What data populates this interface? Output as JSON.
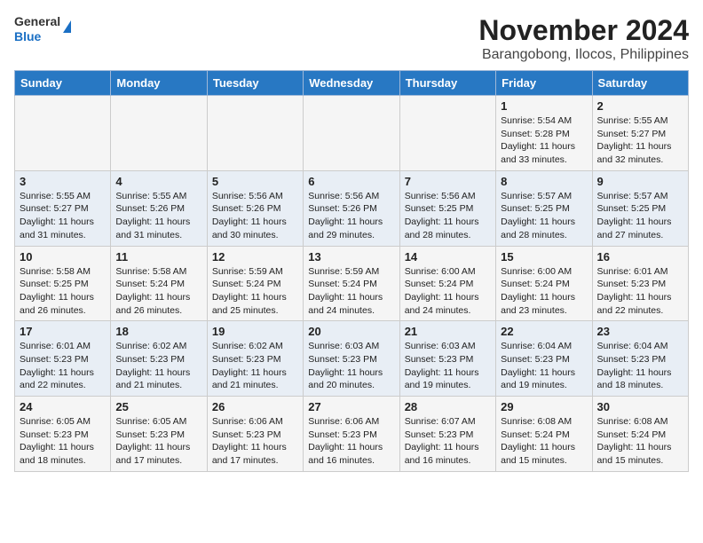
{
  "header": {
    "logo_general": "General",
    "logo_blue": "Blue",
    "title": "November 2024",
    "subtitle": "Barangobong, Ilocos, Philippines"
  },
  "weekdays": [
    "Sunday",
    "Monday",
    "Tuesday",
    "Wednesday",
    "Thursday",
    "Friday",
    "Saturday"
  ],
  "weeks": [
    [
      {
        "day": "",
        "info": ""
      },
      {
        "day": "",
        "info": ""
      },
      {
        "day": "",
        "info": ""
      },
      {
        "day": "",
        "info": ""
      },
      {
        "day": "",
        "info": ""
      },
      {
        "day": "1",
        "info": "Sunrise: 5:54 AM\nSunset: 5:28 PM\nDaylight: 11 hours\nand 33 minutes."
      },
      {
        "day": "2",
        "info": "Sunrise: 5:55 AM\nSunset: 5:27 PM\nDaylight: 11 hours\nand 32 minutes."
      }
    ],
    [
      {
        "day": "3",
        "info": "Sunrise: 5:55 AM\nSunset: 5:27 PM\nDaylight: 11 hours\nand 31 minutes."
      },
      {
        "day": "4",
        "info": "Sunrise: 5:55 AM\nSunset: 5:26 PM\nDaylight: 11 hours\nand 31 minutes."
      },
      {
        "day": "5",
        "info": "Sunrise: 5:56 AM\nSunset: 5:26 PM\nDaylight: 11 hours\nand 30 minutes."
      },
      {
        "day": "6",
        "info": "Sunrise: 5:56 AM\nSunset: 5:26 PM\nDaylight: 11 hours\nand 29 minutes."
      },
      {
        "day": "7",
        "info": "Sunrise: 5:56 AM\nSunset: 5:25 PM\nDaylight: 11 hours\nand 28 minutes."
      },
      {
        "day": "8",
        "info": "Sunrise: 5:57 AM\nSunset: 5:25 PM\nDaylight: 11 hours\nand 28 minutes."
      },
      {
        "day": "9",
        "info": "Sunrise: 5:57 AM\nSunset: 5:25 PM\nDaylight: 11 hours\nand 27 minutes."
      }
    ],
    [
      {
        "day": "10",
        "info": "Sunrise: 5:58 AM\nSunset: 5:25 PM\nDaylight: 11 hours\nand 26 minutes."
      },
      {
        "day": "11",
        "info": "Sunrise: 5:58 AM\nSunset: 5:24 PM\nDaylight: 11 hours\nand 26 minutes."
      },
      {
        "day": "12",
        "info": "Sunrise: 5:59 AM\nSunset: 5:24 PM\nDaylight: 11 hours\nand 25 minutes."
      },
      {
        "day": "13",
        "info": "Sunrise: 5:59 AM\nSunset: 5:24 PM\nDaylight: 11 hours\nand 24 minutes."
      },
      {
        "day": "14",
        "info": "Sunrise: 6:00 AM\nSunset: 5:24 PM\nDaylight: 11 hours\nand 24 minutes."
      },
      {
        "day": "15",
        "info": "Sunrise: 6:00 AM\nSunset: 5:24 PM\nDaylight: 11 hours\nand 23 minutes."
      },
      {
        "day": "16",
        "info": "Sunrise: 6:01 AM\nSunset: 5:23 PM\nDaylight: 11 hours\nand 22 minutes."
      }
    ],
    [
      {
        "day": "17",
        "info": "Sunrise: 6:01 AM\nSunset: 5:23 PM\nDaylight: 11 hours\nand 22 minutes."
      },
      {
        "day": "18",
        "info": "Sunrise: 6:02 AM\nSunset: 5:23 PM\nDaylight: 11 hours\nand 21 minutes."
      },
      {
        "day": "19",
        "info": "Sunrise: 6:02 AM\nSunset: 5:23 PM\nDaylight: 11 hours\nand 21 minutes."
      },
      {
        "day": "20",
        "info": "Sunrise: 6:03 AM\nSunset: 5:23 PM\nDaylight: 11 hours\nand 20 minutes."
      },
      {
        "day": "21",
        "info": "Sunrise: 6:03 AM\nSunset: 5:23 PM\nDaylight: 11 hours\nand 19 minutes."
      },
      {
        "day": "22",
        "info": "Sunrise: 6:04 AM\nSunset: 5:23 PM\nDaylight: 11 hours\nand 19 minutes."
      },
      {
        "day": "23",
        "info": "Sunrise: 6:04 AM\nSunset: 5:23 PM\nDaylight: 11 hours\nand 18 minutes."
      }
    ],
    [
      {
        "day": "24",
        "info": "Sunrise: 6:05 AM\nSunset: 5:23 PM\nDaylight: 11 hours\nand 18 minutes."
      },
      {
        "day": "25",
        "info": "Sunrise: 6:05 AM\nSunset: 5:23 PM\nDaylight: 11 hours\nand 17 minutes."
      },
      {
        "day": "26",
        "info": "Sunrise: 6:06 AM\nSunset: 5:23 PM\nDaylight: 11 hours\nand 17 minutes."
      },
      {
        "day": "27",
        "info": "Sunrise: 6:06 AM\nSunset: 5:23 PM\nDaylight: 11 hours\nand 16 minutes."
      },
      {
        "day": "28",
        "info": "Sunrise: 6:07 AM\nSunset: 5:23 PM\nDaylight: 11 hours\nand 16 minutes."
      },
      {
        "day": "29",
        "info": "Sunrise: 6:08 AM\nSunset: 5:24 PM\nDaylight: 11 hours\nand 15 minutes."
      },
      {
        "day": "30",
        "info": "Sunrise: 6:08 AM\nSunset: 5:24 PM\nDaylight: 11 hours\nand 15 minutes."
      }
    ]
  ]
}
